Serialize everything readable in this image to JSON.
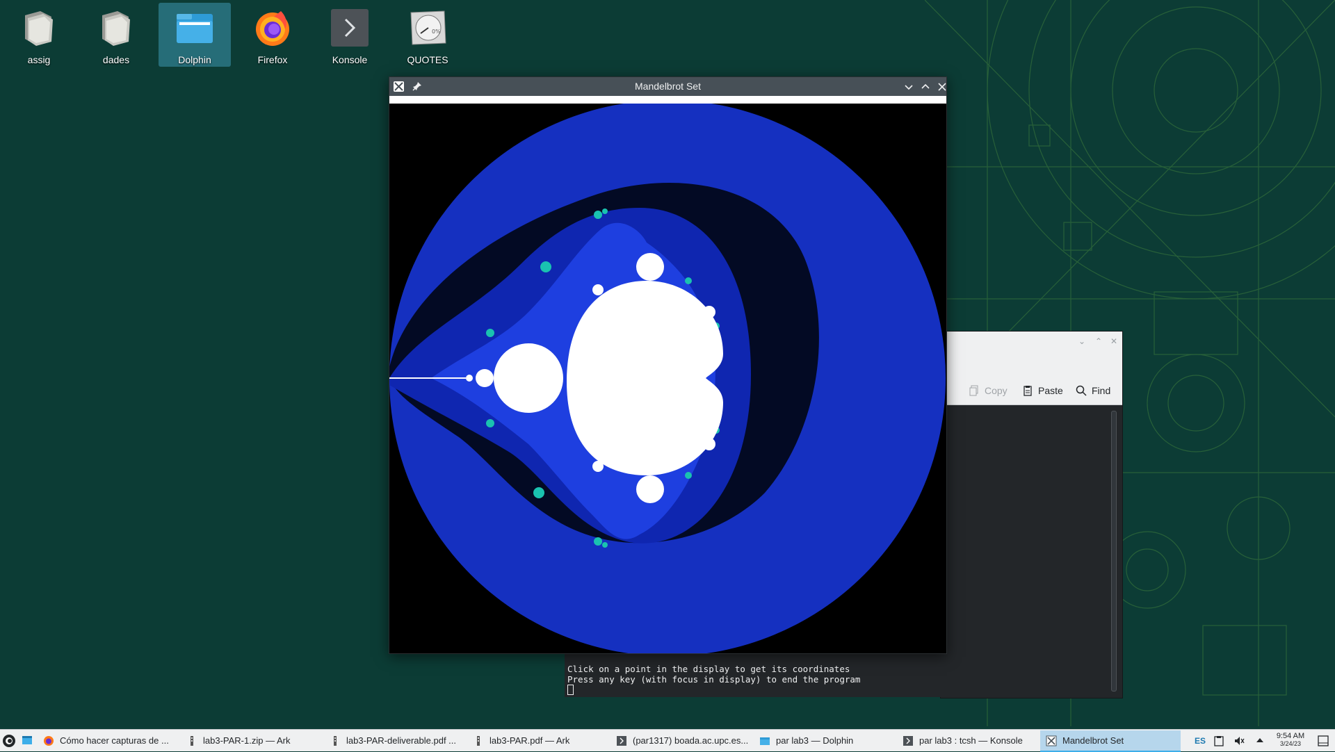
{
  "desktop": {
    "icons": [
      {
        "label": "assig",
        "icon": "folder-gray-icon"
      },
      {
        "label": "dades",
        "icon": "folder-gray-icon"
      },
      {
        "label": "Dolphin",
        "icon": "dolphin-folder-icon",
        "selected": true
      },
      {
        "label": "Firefox",
        "icon": "firefox-icon"
      },
      {
        "label": "Konsole",
        "icon": "konsole-terminal-icon"
      },
      {
        "label": "QUOTES",
        "icon": "quotes-gauge-icon"
      }
    ]
  },
  "mandelbrot_window": {
    "title": "Mandelbrot Set"
  },
  "konsole_window": {
    "toolbar": {
      "copy_label": "Copy",
      "paste_label": "Paste",
      "find_label": "Find"
    },
    "terminal_lines": [
      "Click on a point in the display to get its coordinates",
      "Press any key (with focus in display) to end the program"
    ]
  },
  "taskbar": {
    "tasks": [
      {
        "label": "Cómo hacer capturas de ...",
        "icon": "firefox-icon"
      },
      {
        "label": "lab3-PAR-1.zip — Ark",
        "icon": "ark-icon"
      },
      {
        "label": "lab3-PAR-deliverable.pdf ...",
        "icon": "ark-icon"
      },
      {
        "label": "lab3-PAR.pdf — Ark",
        "icon": "ark-icon"
      },
      {
        "label": "(par1317) boada.ac.upc.es...",
        "icon": "konsole-icon"
      },
      {
        "label": "par lab3 — Dolphin",
        "icon": "dolphin-icon"
      },
      {
        "label": "par lab3 : tcsh — Konsole",
        "icon": "konsole-icon"
      },
      {
        "label": "Mandelbrot Set",
        "icon": "x-window-icon",
        "active": true
      }
    ],
    "keyboard_layout": "ES",
    "clock_time": "9:54 AM",
    "clock_date": "3/24/23"
  },
  "colors": {
    "desktop_bg": "#0c3c35",
    "mandel_outer": "#1530c0",
    "mandel_dark": "#030a24",
    "mandel_inner": "#0f26b0",
    "taskbar_active": "#b6d6ec",
    "accent": "#3daee9"
  }
}
